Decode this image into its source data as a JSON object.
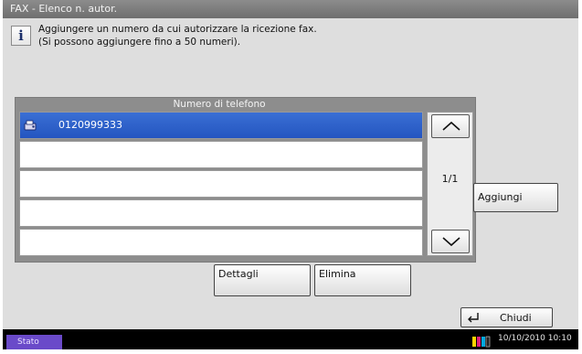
{
  "window": {
    "title": "FAX - Elenco n. autor."
  },
  "message": {
    "line1": "Aggiungere un numero da cui autorizzare la ricezione fax.",
    "line2": "(Si possono aggiungere fino a 50 numeri)."
  },
  "list": {
    "header": "Numero di telefono",
    "rows": [
      {
        "number": "0120999333",
        "selected": true
      },
      {
        "number": "",
        "selected": false
      },
      {
        "number": "",
        "selected": false
      },
      {
        "number": "",
        "selected": false
      },
      {
        "number": "",
        "selected": false
      }
    ],
    "page_indicator": "1/1"
  },
  "buttons": {
    "add": "Aggiungi",
    "details": "Dettagli",
    "delete": "Elimina",
    "close": "Chiudi"
  },
  "status": {
    "stato": "Stato",
    "datetime": "10/10/2010  10:10"
  },
  "colors": {
    "selected_row": "#2f62cc",
    "status_badge": "#6a4ac9"
  }
}
